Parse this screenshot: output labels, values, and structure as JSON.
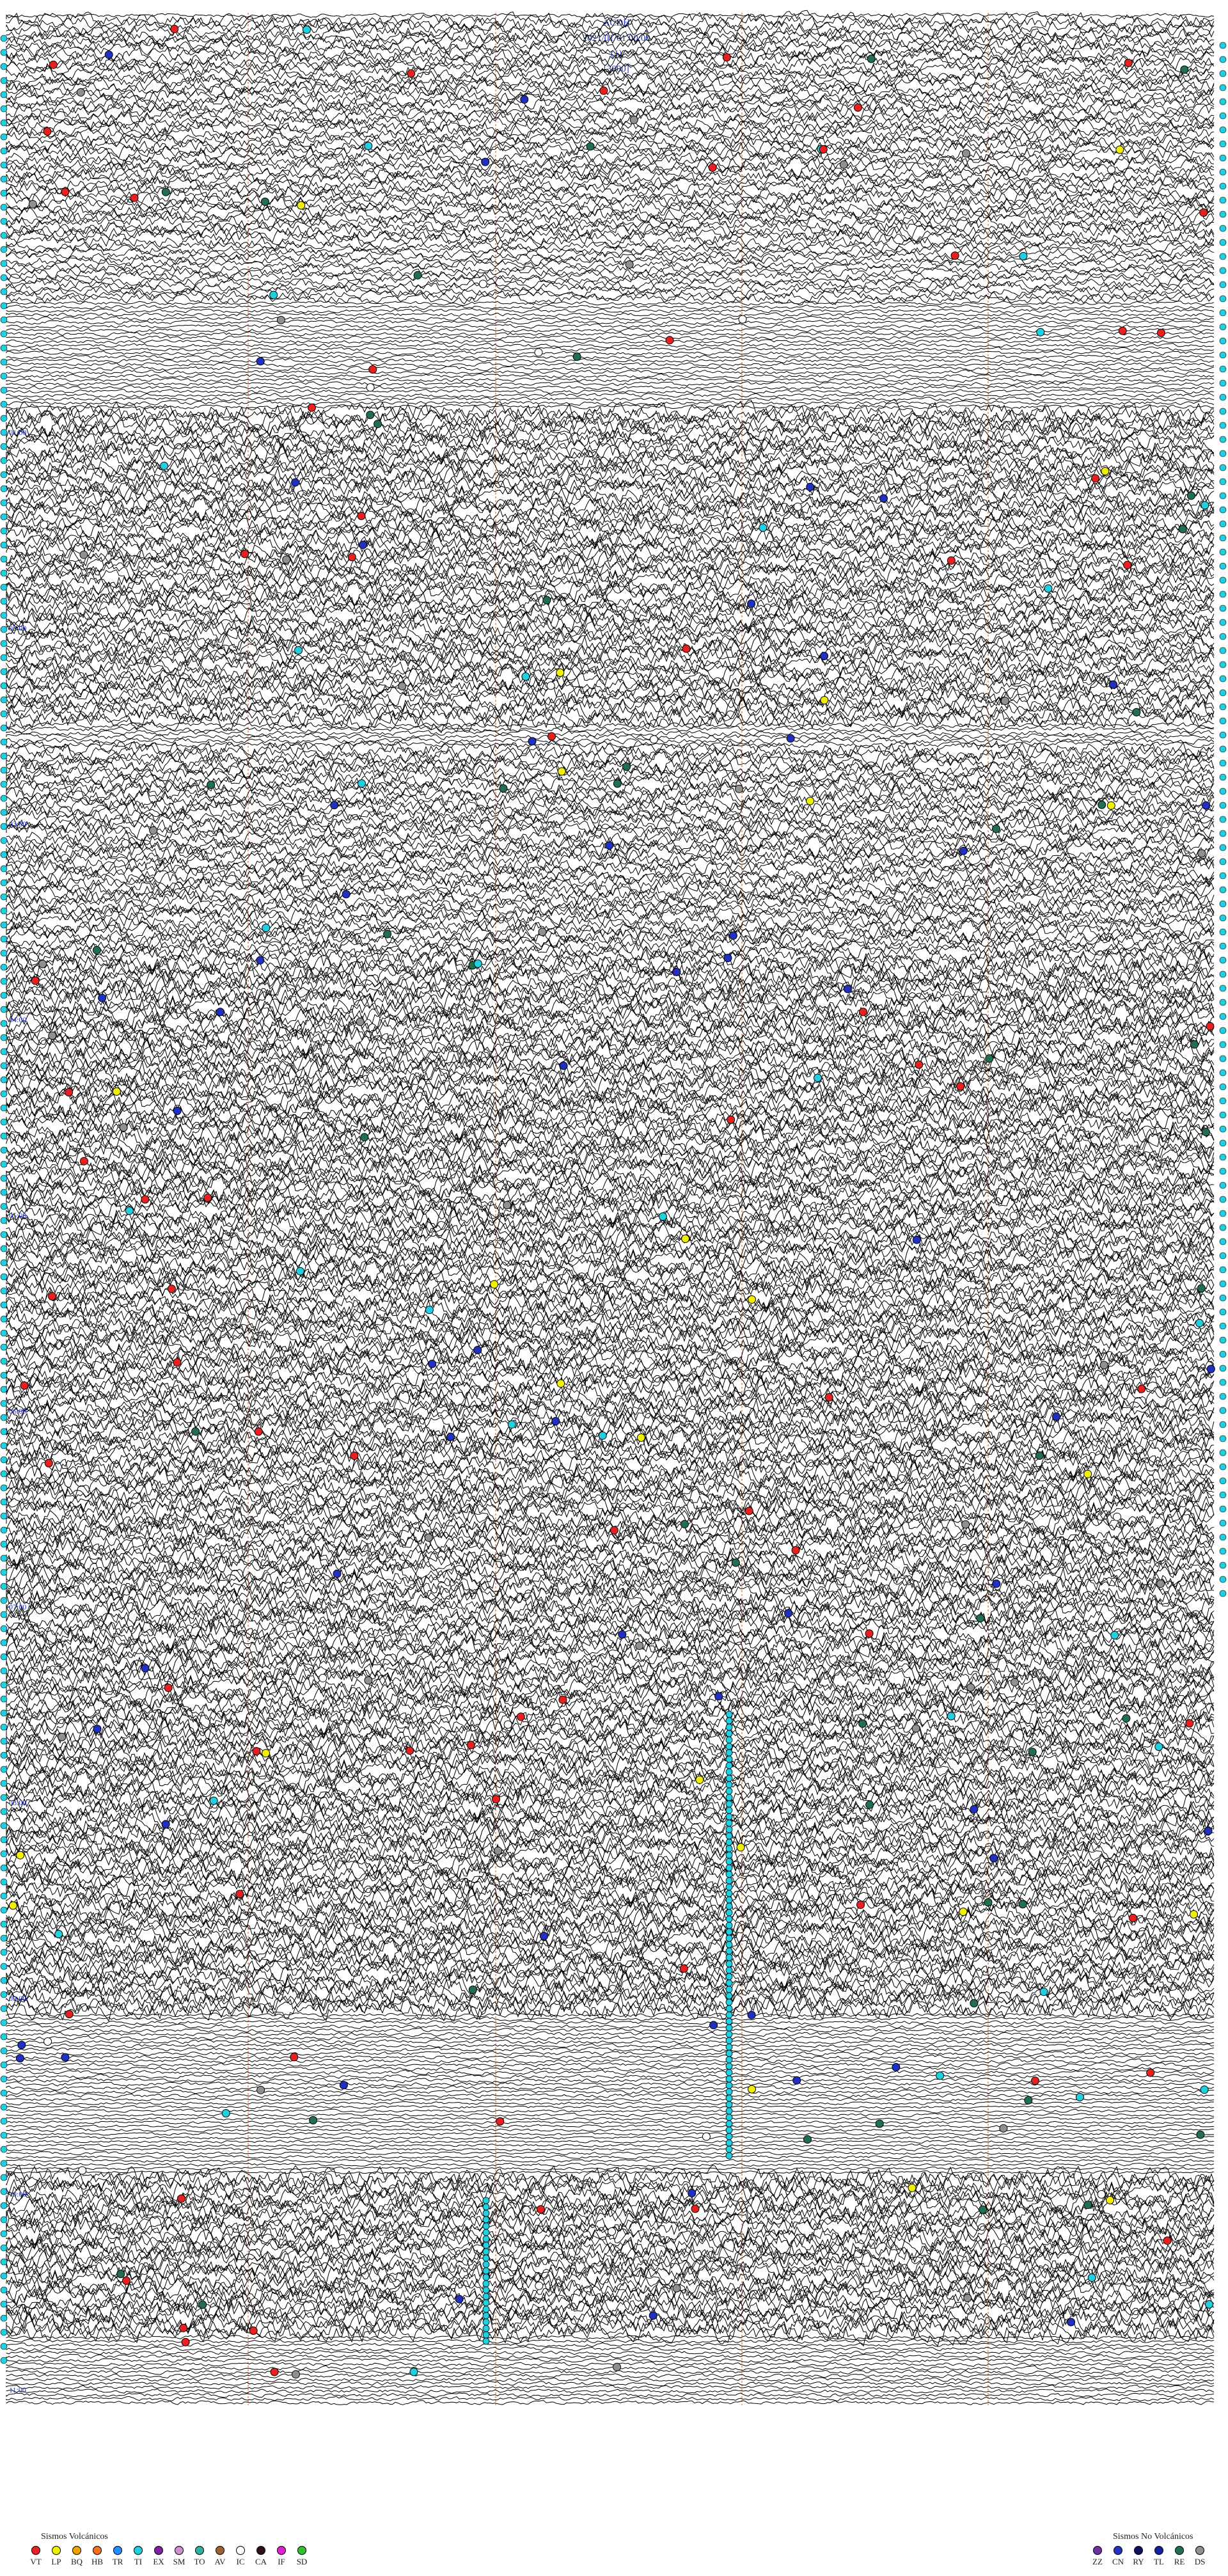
{
  "header": {
    "station": "ACDH",
    "datetime": "2021/01/01 00:00",
    "channel": "(1)",
    "scale": "[3000]"
  },
  "time_labels": [
    "01:00",
    "02:00",
    "03:00",
    "04:00",
    "05:00",
    "06:00",
    "07:00",
    "08:00",
    "09:00",
    "10:00",
    "11:00",
    "12:00",
    "13:00",
    "14:00",
    "15:00",
    "16:00",
    "17:00",
    "18:00",
    "19:00",
    "20:00",
    "21:00",
    "22:00",
    "23:00"
  ],
  "legend_volcanic": {
    "title": "Sismos Volcánicos",
    "items": [
      {
        "code": "VT",
        "color": "#e82020"
      },
      {
        "code": "LP",
        "color": "#f0f000"
      },
      {
        "code": "BQ",
        "color": "#f0a000"
      },
      {
        "code": "HB",
        "color": "#f07020"
      },
      {
        "code": "TR",
        "color": "#2090ff"
      },
      {
        "code": "TI",
        "color": "#20d0e0"
      },
      {
        "code": "EX",
        "color": "#8020a0"
      },
      {
        "code": "SM",
        "color": "#d090d0"
      },
      {
        "code": "TO",
        "color": "#30b0a0"
      },
      {
        "code": "AV",
        "color": "#a06030"
      },
      {
        "code": "IC",
        "color": "#ffffff"
      },
      {
        "code": "CA",
        "color": "#301020"
      },
      {
        "code": "IF",
        "color": "#e020d0"
      },
      {
        "code": "SD",
        "color": "#30c030"
      }
    ]
  },
  "legend_nonvolcanic": {
    "title": "Sismos No Volcánicos",
    "items": [
      {
        "code": "ZZ",
        "color": "#7030a0"
      },
      {
        "code": "CN",
        "color": "#2030c0"
      },
      {
        "code": "RY",
        "color": "#101060"
      },
      {
        "code": "TL",
        "color": "#1020a0"
      },
      {
        "code": "RE",
        "color": "#207050"
      },
      {
        "code": "DS",
        "color": "#909090"
      }
    ]
  }
}
